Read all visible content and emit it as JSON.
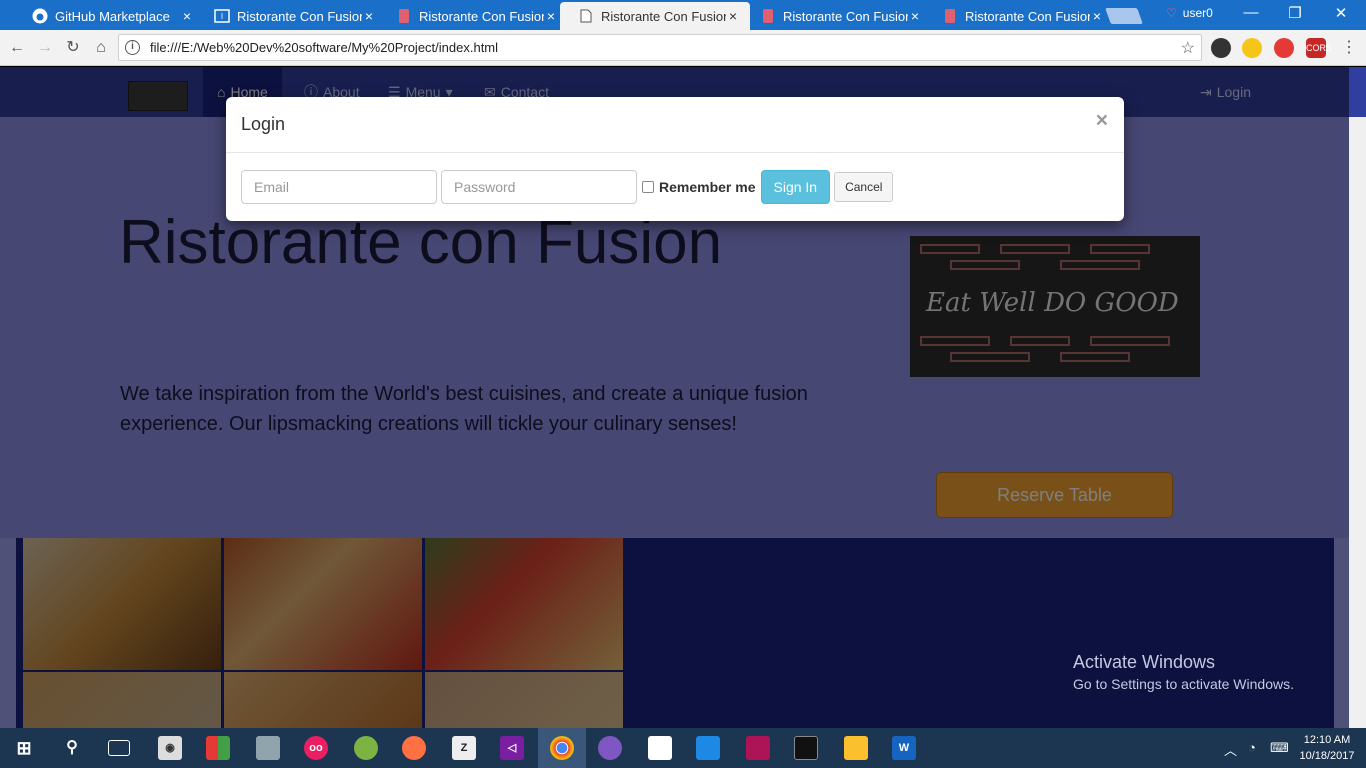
{
  "browser": {
    "tabs": [
      {
        "title": "GitHub Marketplace",
        "icon": "github-icon"
      },
      {
        "title": "Ristorante Con Fusion",
        "icon": "code-icon"
      },
      {
        "title": "Ristorante Con Fusion",
        "icon": "red-file-icon"
      },
      {
        "title": "Ristorante Con Fusion",
        "icon": "page-icon",
        "active": true
      },
      {
        "title": "Ristorante Con Fusion",
        "icon": "red-file-icon"
      },
      {
        "title": "Ristorante Con Fusion",
        "icon": "red-file-icon"
      }
    ],
    "tab_close": "×",
    "user": "user0",
    "url": "file:///E:/Web%20Dev%20software/My%20Project/index.html",
    "window_controls": {
      "minimize": "—",
      "restore": "❐",
      "close": "✕"
    }
  },
  "site": {
    "nav": [
      {
        "label": "Home",
        "icon": "home-icon"
      },
      {
        "label": "About",
        "icon": "info-icon"
      },
      {
        "label": "Menu",
        "icon": "list-icon"
      },
      {
        "label": "Contact",
        "icon": "envelope-icon"
      }
    ],
    "login": "Login",
    "title": "Ristorante con Fusion",
    "tagline": "We take inspiration from the World's best cuisines, and create a unique fusion experience. Our lipsmacking creations will tickle your culinary senses!",
    "brand_image_text": "Eat Well DO GOOD",
    "reserve": "Reserve Table"
  },
  "modal": {
    "title": "Login",
    "close": "×",
    "email_placeholder": "Email",
    "password_placeholder": "Password",
    "remember": "Remember me",
    "signin": "Sign In",
    "cancel": "Cancel"
  },
  "watermark": {
    "line1": "Activate Windows",
    "line2": "Go to Settings to activate Windows."
  },
  "taskbar": {
    "time": "12:10 AM",
    "date": "10/18/2017"
  },
  "colors": {
    "navbar": "#303f9f",
    "jumbotron": "#9575cd",
    "reserve_button": "#ffa726",
    "signin_button": "#5bc0de"
  }
}
